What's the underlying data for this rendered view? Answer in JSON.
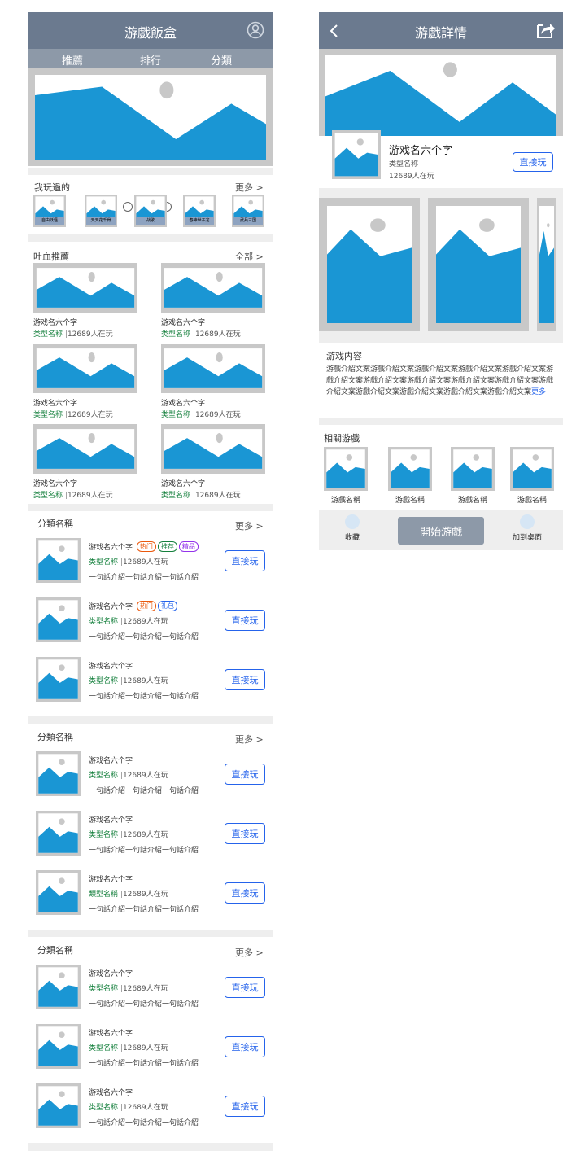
{
  "home": {
    "title": "游戲飯盒",
    "tabs": [
      {
        "label": "推薦"
      },
      {
        "label": "排行"
      },
      {
        "label": "分類"
      }
    ],
    "played": {
      "title": "我玩過的",
      "more": "更多 >",
      "games": [
        {
          "name": "自由妖怪"
        },
        {
          "name": "天天花千骨"
        },
        {
          "name": "战歌"
        },
        {
          "name": "春神世子龙"
        },
        {
          "name": "武兵三国"
        }
      ]
    },
    "recommend": {
      "title": "吐血推薦",
      "more": "全部 >",
      "items": [
        {
          "name": "游戏名六个字",
          "type": "类型名称",
          "sep": "|",
          "count": "12689人在玩"
        },
        {
          "name": "游戏名六个字",
          "type": "类型名称",
          "sep": "|",
          "count": "12689人在玩"
        },
        {
          "name": "游戏名六个字",
          "type": "类型名称",
          "sep": "|",
          "count": "12689人在玩"
        },
        {
          "name": "游戏名六个字",
          "type": "类型名称",
          "sep": "|",
          "count": "12689人在玩"
        },
        {
          "name": "游戏名六个字",
          "type": "类型名称",
          "sep": "|",
          "count": "12689人在玩"
        },
        {
          "name": "游戏名六个字",
          "type": "类型名称",
          "sep": "|",
          "count": "12689人在玩"
        }
      ]
    },
    "categories": [
      {
        "title": "分類名稱",
        "more": "更多 >",
        "rows": [
          {
            "name": "游戏名六个字",
            "badges": [
              "热门",
              "推荐",
              "精品"
            ],
            "type": "类型名称",
            "sep": "|",
            "count": "12689人在玩",
            "desc": "一句話介紹一句話介紹一句話介紹",
            "button": "直接玩"
          },
          {
            "name": "游戏名六个字",
            "badges": [
              "热门",
              "礼包"
            ],
            "type": "类型名称",
            "sep": "|",
            "count": "12689人在玩",
            "desc": "一句話介紹一句話介紹一句話介紹",
            "button": "直接玩"
          },
          {
            "name": "游戏名六个字",
            "badges": [],
            "type": "类型名称",
            "sep": "|",
            "count": "12689人在玩",
            "desc": "一句話介紹一句話介紹一句話介紹",
            "button": "直接玩"
          }
        ]
      },
      {
        "title": "分類名稱",
        "more": "更多 >",
        "rows": [
          {
            "name": "游戏名六个字",
            "badges": [],
            "type": "类型名称",
            "sep": "|",
            "count": "12689人在玩",
            "desc": "一句話介紹一句話介紹一句話介紹",
            "button": "直接玩"
          },
          {
            "name": "游戏名六个字",
            "badges": [],
            "type": "类型名称",
            "sep": "|",
            "count": "12689人在玩",
            "desc": "一句話介紹一句話介紹一句話介紹",
            "button": "直接玩"
          },
          {
            "name": "游戏名六个字",
            "badges": [],
            "type": "類型名稱",
            "sep": "|",
            "count": "12689人在玩",
            "desc": "一句話介紹一句話介紹一句話介紹",
            "button": "直接玩"
          }
        ]
      },
      {
        "title": "分類名稱",
        "more": "更多 >",
        "rows": [
          {
            "name": "游戏名六个字",
            "badges": [],
            "type": "类型名称",
            "sep": "|",
            "count": "12689人在玩",
            "desc": "一句話介紹一句話介紹一句話介紹",
            "button": "直接玩"
          },
          {
            "name": "游戏名六个字",
            "badges": [],
            "type": "类型名称",
            "sep": "|",
            "count": "12689人在玩",
            "desc": "一句話介紹一句話介紹一句話介紹",
            "button": "直接玩"
          },
          {
            "name": "游戏名六个字",
            "badges": [],
            "type": "类型名称",
            "sep": "|",
            "count": "12689人在玩",
            "desc": "一句話介紹一句話介紹一句話介紹",
            "button": "直接玩"
          }
        ]
      }
    ]
  },
  "detail": {
    "title": "游戲詳情",
    "game": {
      "name": "游戏名六个字",
      "type": "类型名称",
      "count": "12689人在玩",
      "button": "直接玩"
    },
    "content_title": "游戏内容",
    "content_text": "游戲介紹文案游戲介紹文案游戲介紹文案游戲介紹文案游戲介紹文案游戲介紹文案游戲介紹文案游戲介紹文案游戲介紹文案游戲介紹文案游戲介紹文案游戲介紹文案游戲介紹文案游戲介紹文案游戲介紹文案",
    "content_more": "更多",
    "related_title": "相關游戲",
    "related": [
      {
        "name": "游戲名稱"
      },
      {
        "name": "游戲名稱"
      },
      {
        "name": "游戲名稱"
      },
      {
        "name": "游戲名稱"
      }
    ],
    "bottom": {
      "favorite": "收藏",
      "start": "開始游戲",
      "desktop": "加到桌面"
    }
  },
  "colors": {
    "header": "#6b7a8f",
    "tabbar": "#8d99a8",
    "placeholder_frame": "#c8c8c8",
    "image_blue": "#1a96d4",
    "accent_blue": "#2563eb",
    "type_green": "#15803d"
  },
  "icons": [
    "user-circle-icon",
    "back-arrow-icon",
    "share-icon",
    "image-placeholder-icon"
  ]
}
